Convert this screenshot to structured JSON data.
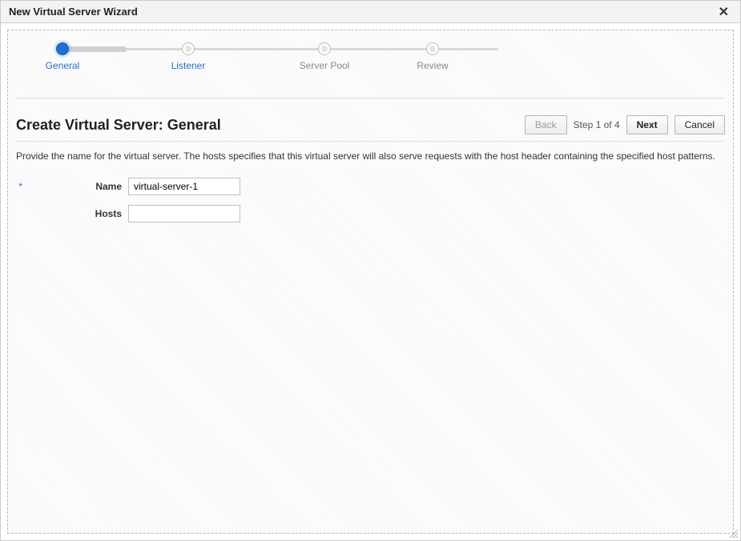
{
  "dialog": {
    "title": "New Virtual Server Wizard",
    "close_label": "✕"
  },
  "wizard": {
    "steps": [
      {
        "label": "General"
      },
      {
        "label": "Listener"
      },
      {
        "label": "Server Pool"
      },
      {
        "label": "Review"
      }
    ]
  },
  "page": {
    "heading": "Create Virtual Server: General",
    "step_indicator": "Step 1 of 4",
    "description": "Provide the name for the virtual server. The hosts specifies that this virtual server will also serve requests with the host header containing the specified host patterns."
  },
  "buttons": {
    "back": "Back",
    "next": "Next",
    "cancel": "Cancel"
  },
  "form": {
    "required_marker": "*",
    "name_label": "Name",
    "name_value": "virtual-server-1",
    "hosts_label": "Hosts",
    "hosts_value": ""
  }
}
